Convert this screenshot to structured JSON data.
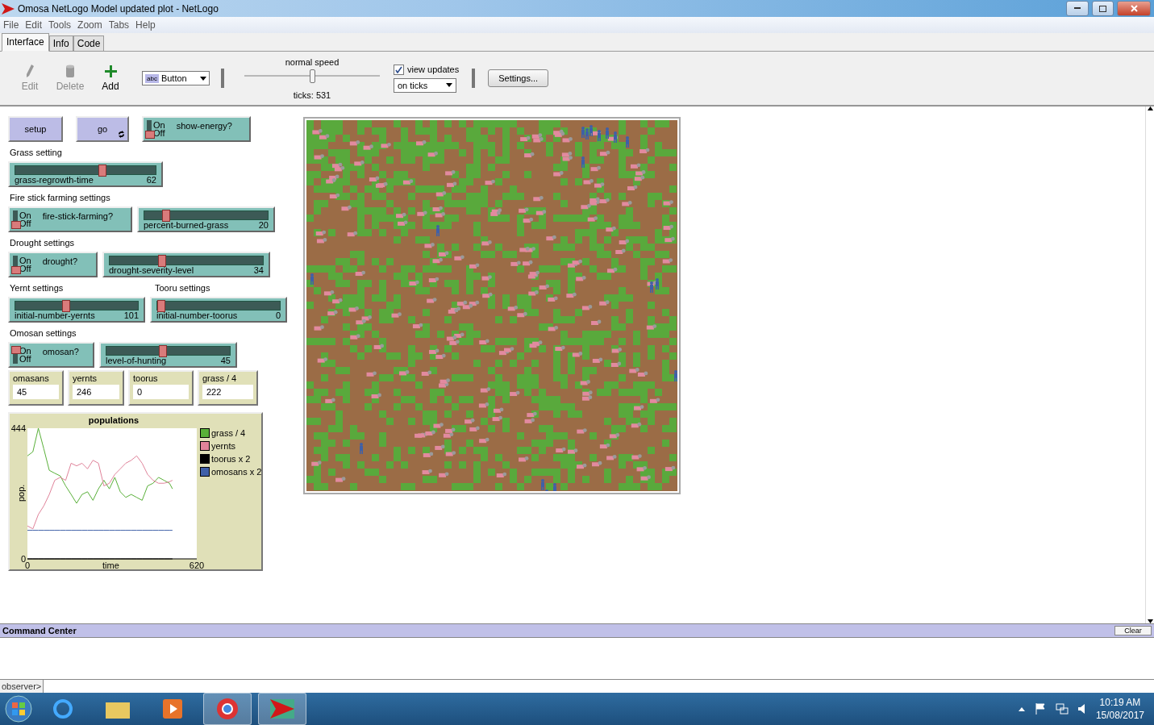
{
  "window": {
    "title": "Omosa NetLogo Model updated plot - NetLogo"
  },
  "menu": [
    "File",
    "Edit",
    "Tools",
    "Zoom",
    "Tabs",
    "Help"
  ],
  "tabs": [
    {
      "label": "Interface",
      "selected": true
    },
    {
      "label": "Info",
      "selected": false
    },
    {
      "label": "Code",
      "selected": false
    }
  ],
  "toolbar": {
    "tools": [
      {
        "label": "Edit",
        "kind": "edit",
        "disabled": true
      },
      {
        "label": "Delete",
        "kind": "delete",
        "disabled": true
      },
      {
        "label": "Add",
        "kind": "add",
        "disabled": false
      }
    ],
    "widget_chooser": {
      "icon_text": "abc",
      "value": "Button"
    },
    "speed": {
      "label": "normal speed",
      "level": 0.5,
      "ticks": "ticks: 531"
    },
    "view_updates": {
      "label": "view updates",
      "checked": true,
      "mode": "on ticks"
    },
    "settings_button": "Settings..."
  },
  "widget_rows": [
    [
      {
        "kind": "button",
        "label": "setup",
        "forever": false
      },
      {
        "kind": "button",
        "label": "go",
        "forever": true
      },
      {
        "kind": "switch",
        "label": "show-energy?",
        "on": false,
        "on_text": "On",
        "off_text": "Off"
      }
    ],
    [
      {
        "kind": "note",
        "label": "Grass setting"
      }
    ],
    [
      {
        "kind": "slider",
        "label": "grass-regrowth-time",
        "value": "62",
        "level": 0.62
      }
    ],
    [
      {
        "kind": "note",
        "label": "Fire stick farming settings"
      }
    ],
    [
      {
        "kind": "switch",
        "label": "fire-stick-farming?",
        "on": false,
        "on_text": "On",
        "off_text": "Off"
      },
      {
        "kind": "slider",
        "label": "percent-burned-grass",
        "value": "20",
        "level": 0.15
      }
    ],
    [
      {
        "kind": "note",
        "label": "Drought settings"
      }
    ],
    [
      {
        "kind": "switch",
        "label": "drought?",
        "on": false,
        "on_text": "On",
        "off_text": "Off"
      },
      {
        "kind": "slider",
        "label": "drought-severity-level",
        "value": "34",
        "level": 0.33
      }
    ],
    [
      {
        "kind": "note",
        "label": "Yernt settings"
      },
      {
        "kind": "note",
        "label": "Tooru settings"
      }
    ],
    [
      {
        "kind": "slider",
        "label": "initial-number-yernts",
        "value": "101",
        "level": 0.4
      },
      {
        "kind": "slider",
        "label": "initial-number-toorus",
        "value": "0",
        "level": 0
      }
    ],
    [
      {
        "kind": "note",
        "label": "Omosan settings"
      }
    ],
    [
      {
        "kind": "switch",
        "label": "omosan?",
        "on": true,
        "on_text": "On",
        "off_text": "Off"
      },
      {
        "kind": "slider",
        "label": "level-of-hunting",
        "value": "45",
        "level": 0.45
      }
    ],
    [
      {
        "kind": "monitor",
        "label": "omasans",
        "value": "45"
      },
      {
        "kind": "monitor",
        "label": "yernts",
        "value": "246"
      },
      {
        "kind": "monitor",
        "label": "toorus",
        "value": "0"
      },
      {
        "kind": "monitor",
        "label": "grass / 4",
        "value": "222"
      }
    ]
  ],
  "plot": {
    "chart_data": {
      "type": "line",
      "title": "populations",
      "xlabel": "time",
      "ylabel": "pop.",
      "xlim": [
        0,
        620
      ],
      "ylim": [
        0,
        444
      ],
      "xticks": [
        0,
        620
      ],
      "yticks": [
        0,
        444
      ],
      "legend": "right",
      "x": [
        0,
        20,
        40,
        60,
        80,
        100,
        120,
        140,
        160,
        180,
        200,
        220,
        240,
        260,
        280,
        300,
        320,
        340,
        360,
        380,
        400,
        420,
        440,
        460,
        480,
        500,
        520,
        531
      ],
      "series": [
        {
          "name": "grass / 4",
          "color": "#59b039",
          "values": [
            350,
            364,
            444,
            374,
            301,
            291,
            282,
            248,
            219,
            189,
            219,
            228,
            199,
            238,
            267,
            238,
            277,
            228,
            209,
            219,
            209,
            199,
            248,
            257,
            277,
            267,
            257,
            238
          ]
        },
        {
          "name": "yernts",
          "color": "#e0839a",
          "values": [
            112,
            102,
            151,
            180,
            219,
            267,
            277,
            267,
            325,
            316,
            325,
            306,
            335,
            325,
            248,
            257,
            287,
            306,
            325,
            335,
            350,
            325,
            287,
            267,
            257,
            257,
            262,
            267
          ]
        },
        {
          "name": "toorus x 2",
          "color": "#000000",
          "values": [
            0,
            0,
            0,
            0,
            0,
            0,
            0,
            0,
            0,
            0,
            0,
            0,
            0,
            0,
            0,
            0,
            0,
            0,
            0,
            0,
            0,
            0,
            0,
            0,
            0,
            0,
            0,
            0
          ]
        },
        {
          "name": "omosans x 2",
          "color": "#3f60a8",
          "values": [
            97,
            97,
            97,
            97,
            97,
            97,
            97,
            97,
            97,
            97,
            97,
            97,
            97,
            97,
            97,
            97,
            97,
            97,
            97,
            97,
            97,
            97,
            97,
            97,
            97,
            97,
            97,
            97
          ]
        }
      ]
    }
  },
  "command_center": {
    "title": "Command Center",
    "clear_button": "Clear",
    "prompt": "observer>"
  },
  "taskbar": {
    "time": "10:19 AM",
    "date": "15/08/2017"
  }
}
